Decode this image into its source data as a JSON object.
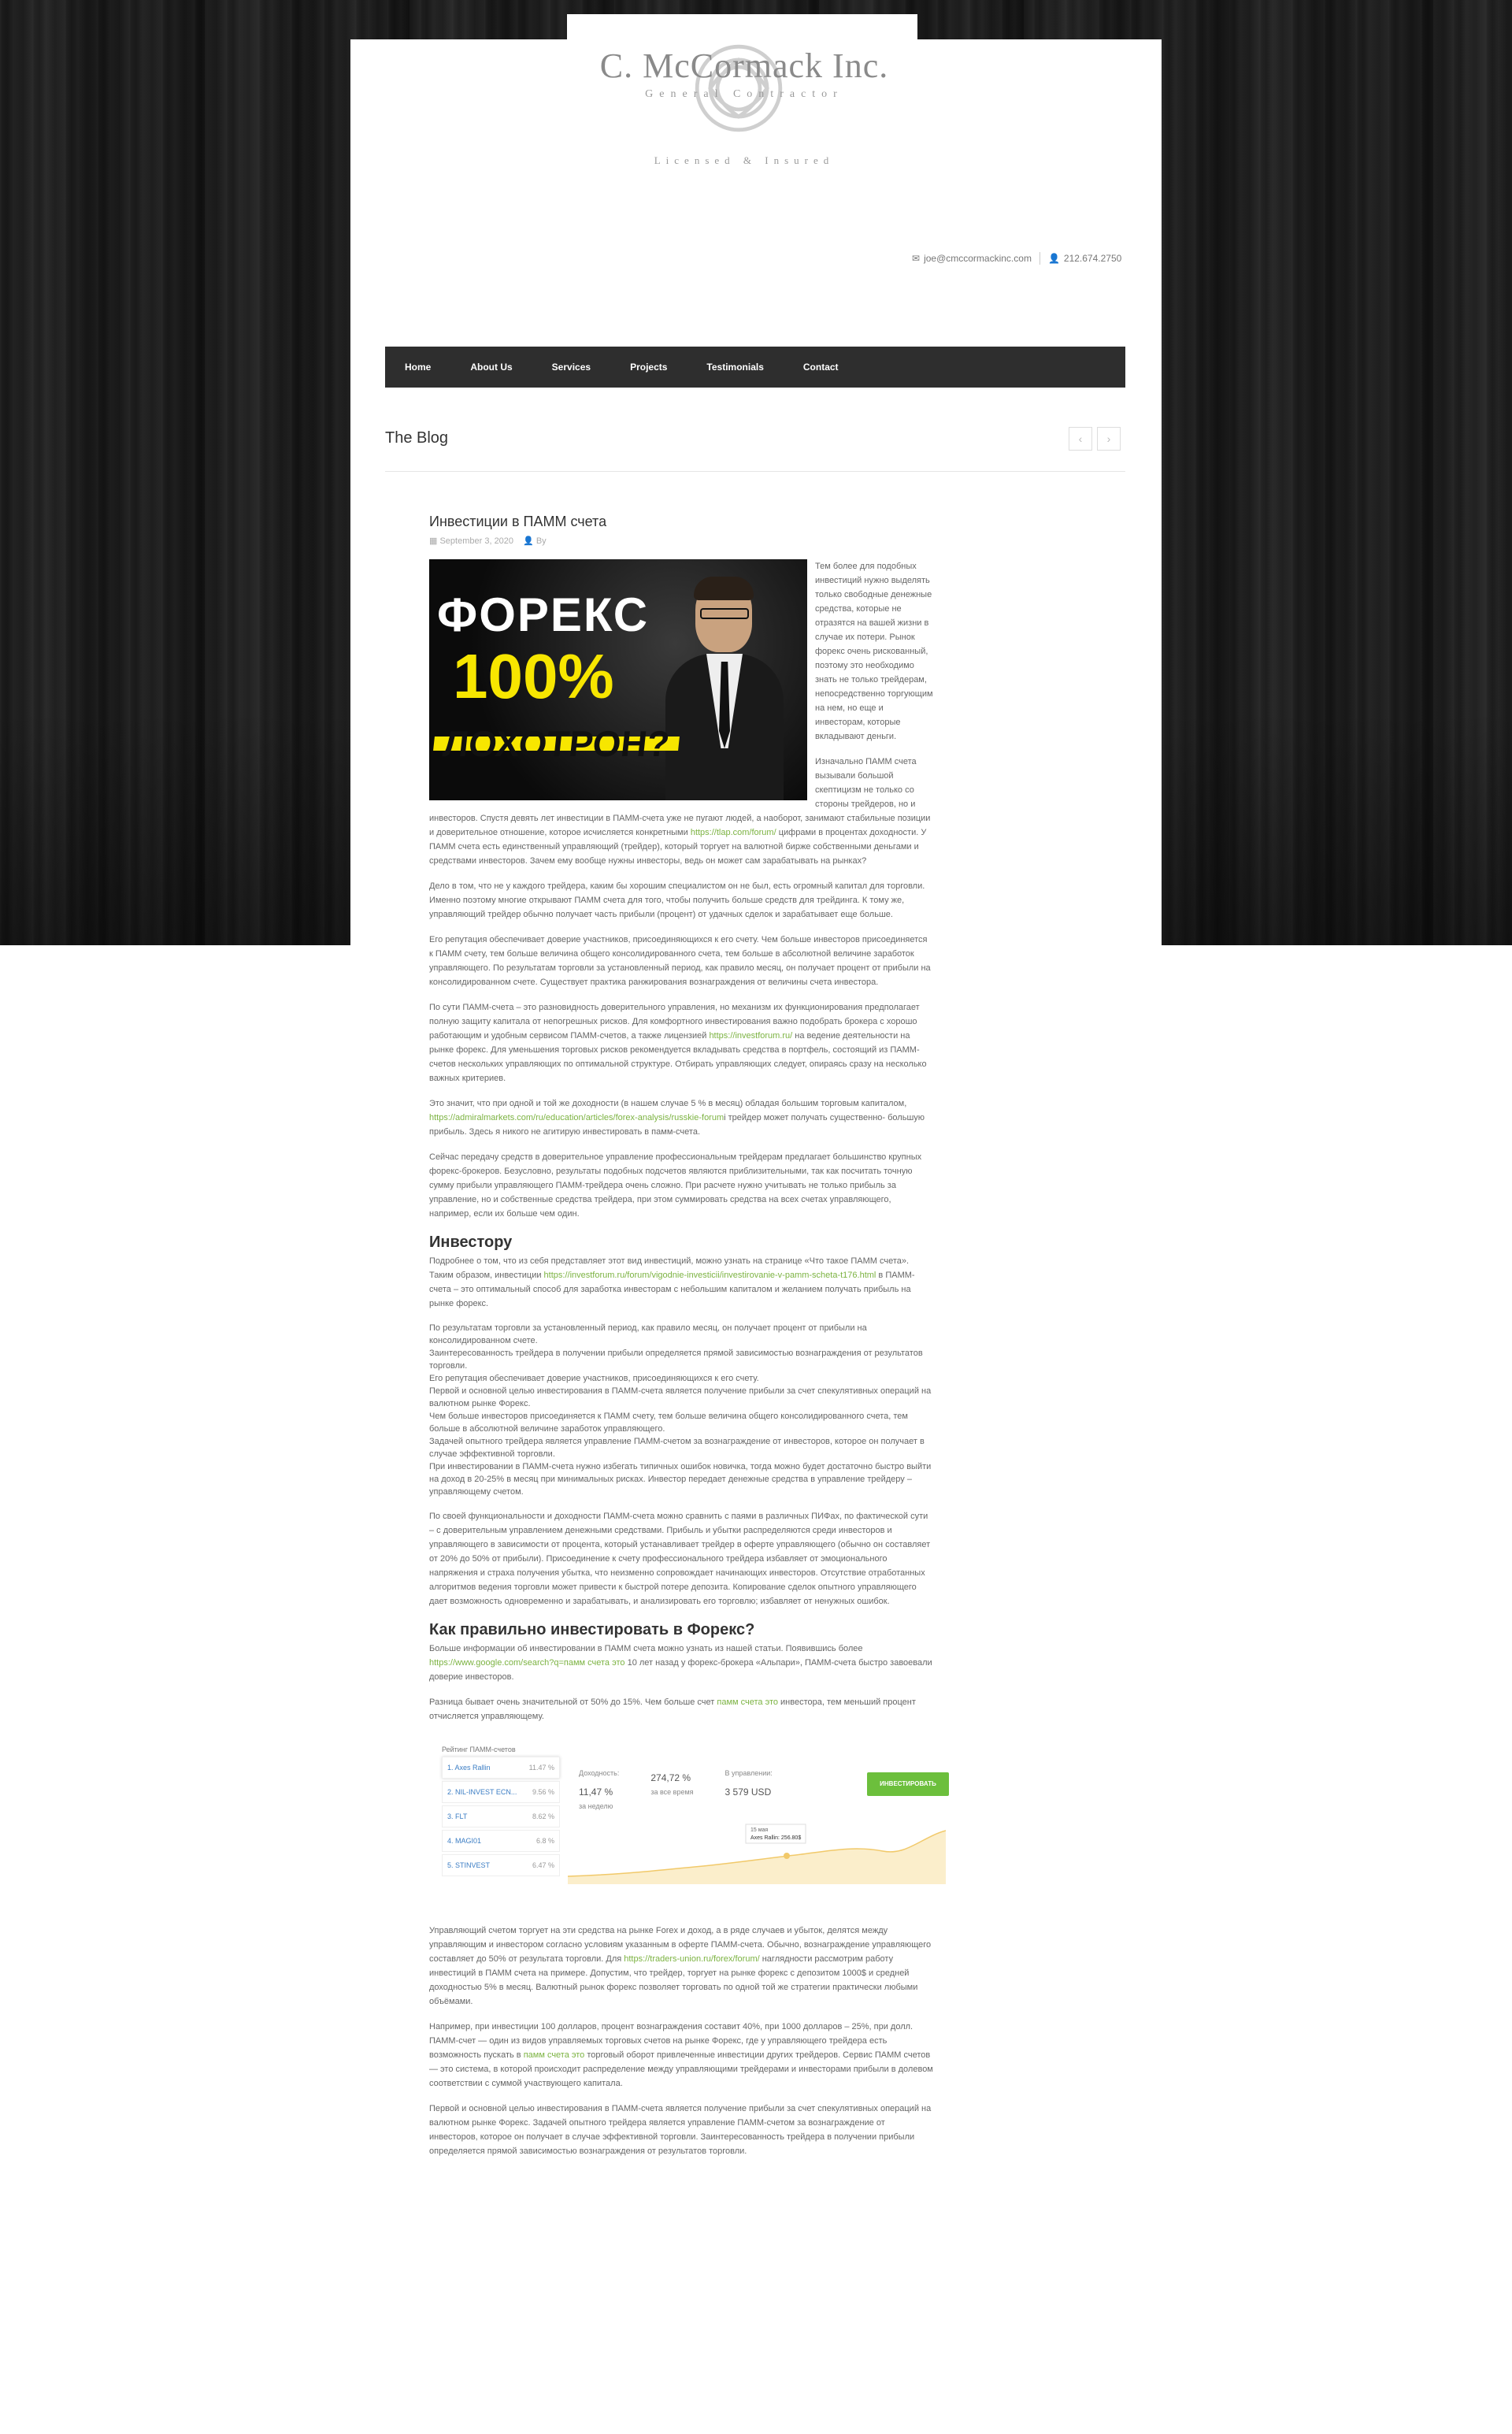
{
  "brand": {
    "name": "C. McCormack Inc.",
    "subtitle": "General Contractor",
    "tagline": "Licensed & Insured"
  },
  "contact": {
    "email": "joe@cmccormackinc.com",
    "phone": "212.674.2750"
  },
  "nav": [
    "Home",
    "About Us",
    "Services",
    "Projects",
    "Testimonials",
    "Contact"
  ],
  "blog": {
    "title": "The Blog",
    "prev_icon": "‹",
    "next_icon": "›"
  },
  "post": {
    "title": "Инвестиции в ПАММ счета",
    "date": "September 3, 2020",
    "author_label": "By",
    "hero": {
      "line1": "ФОРЕКС",
      "line2": "100%",
      "line3": "ЛОХОТРОН?"
    },
    "p1": "Тем более для подобных инвестиций нужно выделять только свободные денежные средства, которые не отразятся на вашей жизни в случае их потери. Рынок форекс очень рискованный, поэтому это необходимо знать не только трейдерам, непосредственно торгующим на нем, но еще и инвесторам, которые вкладывают деньги.",
    "p2_a": "Изначально ПАММ счета вызывали большой скептицизм не только со стороны трейдеров, но и инвесторов. Спустя девять лет инвестиции в ПАММ-счета уже не пугают людей, а наоборот, занимают стабильные позиции и доверительное отношение, которое исчисляется конкретными ",
    "p2_link": "https://tlap.com/forum/",
    "p2_b": " цифрами в процентах доходности. У ПАММ счета есть единственный управляющий (трейдер), который торгует на валютной бирже собственными деньгами и средствами инвесторов. Зачем ему вообще нужны инвесторы, ведь он может сам зарабатывать на рынках?",
    "p3": "Дело в том, что не у каждого трейдера, каким бы хорошим специалистом он не был, есть огромный капитал для торговли. Именно поэтому многие открывают ПАММ счета для того, чтобы получить больше средств для трейдинга. К тому же, управляющий трейдер обычно получает часть прибыли (процент) от удачных сделок и зарабатывает еще больше.",
    "p4": "Его репутация обеспечивает доверие участников, присоединяющихся к его счету. Чем больше инвесторов присоединяется к ПАММ счету, тем больше величина общего консолидированного счета, тем больше в абсолютной величине заработок управляющего. По результатам торговли за установленный период, как правило месяц, он получает процент от прибыли на консолидированном счете. Существует практика ранжирования вознаграждения от величины счета инвестора.",
    "p5_a": "По сути ПАММ-счета – это разновидность доверительного управления, но механизм их функционирования предполагает полную защиту капитала от непогрешных рисков. Для комфортного инвестирования важно подобрать брокера с хорошо работающим и удобным сервисом ПАММ-счетов, а также лицензией ",
    "p5_link": "https://investforum.ru/",
    "p5_b": " на ведение деятельности на рынке форекс. Для уменьшения торговых рисков рекомендуется вкладывать средства в портфель, состоящий из ПАММ-счетов нескольких управляющих по оптимальной структуре. Отбирать управляющих следует, опираясь сразу на несколько важных критериев.",
    "p6_a": "Это значит, что при одной и той же доходности (в нашем случае 5 % в месяц) обладая большим торговым капиталом, ",
    "p6_link": "https://admiralmarkets.com/ru/education/articles/forex-analysis/russkie-forum",
    "p6_b": "i трейдер может получать существенно- большую прибыль. Здесь я никого не агитирую инвестировать в памм-счета.",
    "p7": "Сейчас передачу средств в доверительное управление профессиональным трейдерам предлагает большинство крупных форекс-брокеров. Безусловно, результаты подобных подсчетов являются приблизительными, так как посчитать точную сумму прибыли управляющего ПАММ-трейдера очень сложно. При расчете нужно учитывать не только прибыль за управление, но и собственные средства трейдера, при этом суммировать средства на всех счетах управляющего, например, если их больше чем один.",
    "h_investor": "Инвестору",
    "p8_a": "Подробнее о том, что из себя представляет этот вид инвестиций, можно узнать на странице «Что такое ПАММ счета». Таким образом, инвестиции ",
    "p8_link": "https://investforum.ru/forum/vigodnie-investicii/investirovanie-v-pamm-scheta-t176.html",
    "p8_b": " в ПАММ-счета – это оптимальный способ для заработка инвесторам с небольшим капиталом и желанием получать прибыль на рынке форекс.",
    "p9": "По результатам торговли за установленный период, как правило месяц, он получает процент от прибыли на консолидированном счете.\nЗаинтересованность трейдера в получении прибыли определяется прямой зависимостью вознаграждения от результатов торговли.\nЕго репутация обеспечивает доверие участников, присоединяющихся к его счету.\nПервой и основной целью инвестирования в ПАММ-счета является получение прибыли за счет спекулятивных операций на валютном рынке Форекс.\nЧем больше инвесторов присоединяется к ПАММ счету, тем больше величина общего консолидированного счета, тем больше в абсолютной величине заработок управляющего.\nЗадачей опытного трейдера является управление ПАММ-счетом за вознаграждение от инвесторов, которое он получает в случае эффективной торговли.\nПри инвестировании в ПАММ-счета нужно избегать типичных ошибок новичка, тогда можно будет достаточно быстро выйти на доход в 20-25% в месяц при минимальных рисках. Инвестор передает денежные средства в управление трейдеру – управляющему счетом.",
    "p10": "По своей функциональности и доходности ПАММ-счета можно сравнить с паями в различных ПИФах, по фактической сути – с доверительным управлением денежными средствами. Прибыль и убытки распределяются среди инвесторов и управляющего в зависимости от процента, который устанавливает трейдер в оферте управляющего (обычно он составляет от 20% до 50% от прибыли). Присоединение к счету профессионального трейдера избавляет от эмоционального напряжения и страха получения убытка, что неизменно сопровождает начинающих инвесторов. Отсутствие отработанных алгоритмов ведения торговли может привести к быстрой потере депозита. Копирование сделок опытного управляющего дает возможность одновременно и зарабатывать, и анализировать его торговлю; избавляет от ненужных ошибок.",
    "h_forex": "Как правильно инвестировать в Форекс?",
    "p11_a": "Больше информации об инвестировании в ПАММ счета можно узнать из нашей статьи. Появившись более ",
    "p11_link": "https://www.google.com/search?q=памм счета это",
    "p11_b": " 10 лет назад у форекс-брокера «Альпари», ПАММ-счета быстро завоевали доверие инвесторов.",
    "p12_a": "Разница бывает очень значительной от 50% до 15%. Чем больше счет ",
    "p12_link": "памм счета это",
    "p12_b": " инвестора, тем меньший процент отчисляется управляющему.",
    "p13_a": "Управляющий счетом торгует на эти средства на рынке Forex и доход, а в ряде случаев и убыток, делятся между управляющим и инвестором согласно условиям указанным в оферте ПАММ-счета. Обычно, вознаграждение управляющего составляет до 50% от результата торговли. Для ",
    "p13_link": "https://traders-union.ru/forex/forum/",
    "p13_b": " наглядности рассмотрим работу инвестиций в ПАММ счета на примере. Допустим, что трейдер, торгует на рынке форекс с депозитом 1000$ и средней доходностью 5% в месяц. Валютный рынок форекс позволяет торговать по одной той же стратегии практически любыми объёмами.",
    "p14_a": "Например, при инвестиции 100 долларов, процент вознаграждения составит 40%, при 1000 долларов – 25%, при долл. ПАММ-счет — один из видов управляемых торговых счетов на рынке Форекс, где у управляющего трейдера есть возможность пускать в ",
    "p14_link": "памм счета это",
    "p14_b": " торговый оборот привлеченные инвестиции других трейдеров. Сервис ПАММ счетов — это система, в которой происходит распределение между управляющими трейдерами и инвесторами прибыли в долевом соответствии с суммой участвующего капитала.",
    "p15": "Первой и основной целью инвестирования в ПАММ-счета является получение прибыли за счет спекулятивных операций на валютном рынке Форекс. Задачей опытного трейдера является управление ПАММ-счетом за вознаграждение от инвесторов, которое он получает в случае эффективной торговли. Заинтересованность трейдера в получении прибыли определяется прямой зависимостью вознаграждения от результатов торговли."
  },
  "widget": {
    "title": "Рейтинг ПАММ-счетов",
    "items": [
      {
        "name": "1. Axes Rallin",
        "value": "11.47 %"
      },
      {
        "name": "2. NIL-INVEST ECN...",
        "value": "9.56 %"
      },
      {
        "name": "3. FLT",
        "value": "8.62 %"
      },
      {
        "name": "4. MAGI01",
        "value": "6.8 %"
      },
      {
        "name": "5. STINVEST",
        "value": "6.47 %"
      }
    ],
    "stats": [
      {
        "label": "Доходность:",
        "value": "11,47 %",
        "sub": "за неделю"
      },
      {
        "label": "",
        "value": "274,72 %",
        "sub": "за все время"
      },
      {
        "label": "В управлении:",
        "value": "3 579 USD",
        "sub": ""
      }
    ],
    "button": "ИНВЕСТИРОВАТЬ",
    "tooltip_date": "15 мая",
    "tooltip_value": "Axes Rallin: 256.80$"
  }
}
